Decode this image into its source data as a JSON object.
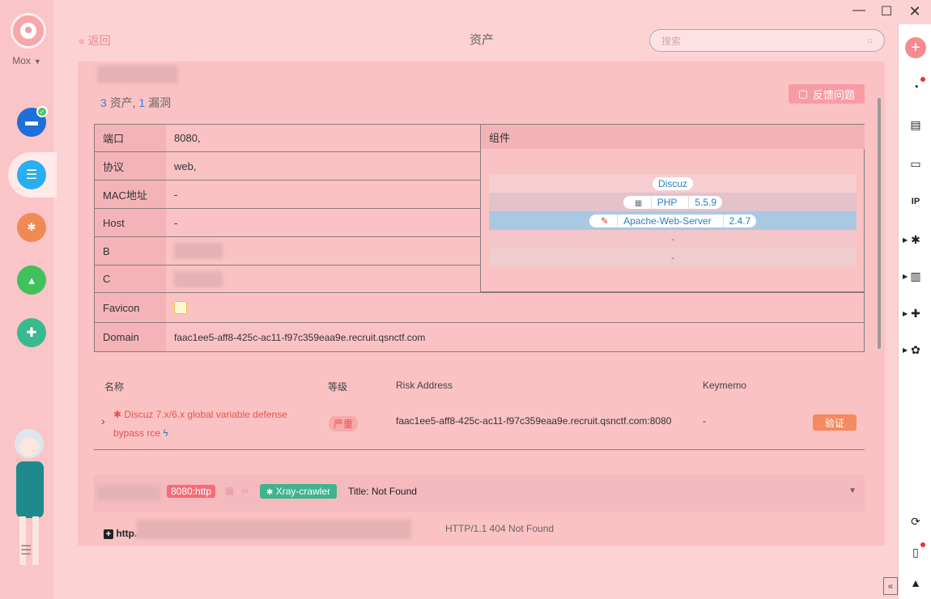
{
  "sidebar": {
    "user": "Mox",
    "nav": [
      {
        "name": "scan-icon",
        "color": "#1e6fd8"
      },
      {
        "name": "assets-icon",
        "color": "#2aaef0"
      },
      {
        "name": "bug-icon",
        "color": "#f08a55"
      },
      {
        "name": "chart-icon",
        "color": "#3fc15c"
      },
      {
        "name": "plugin-icon",
        "color": "#38b98f"
      }
    ]
  },
  "header": {
    "back_label": "返回",
    "title": "资产",
    "search_placeholder": "搜索"
  },
  "summary": {
    "asset_count": "3",
    "asset_label": "资产,",
    "vuln_count": "1",
    "vuln_label": "漏洞"
  },
  "feedback_label": "反馈问题",
  "info": {
    "port_label": "端口",
    "port_value": "8080,",
    "protocol_label": "协议",
    "protocol_value": "web,",
    "mac_label": "MAC地址",
    "mac_value": "-",
    "host_label": "Host",
    "host_value": "-",
    "b_label": "B",
    "c_label": "C",
    "favicon_label": "Favicon",
    "domain_label": "Domain",
    "domain_value": "faac1ee5-aff8-425c-ac11-f97c359eaa9e.recruit.qsnctf.com"
  },
  "components": {
    "header": "组件",
    "items": [
      {
        "name": "Discuz",
        "version": ""
      },
      {
        "name": "PHP",
        "version": "5.5.9"
      },
      {
        "name": "Apache-Web-Server",
        "version": "2.4.7"
      },
      {
        "name": "-",
        "version": ""
      },
      {
        "name": "-",
        "version": ""
      }
    ]
  },
  "vuln_table": {
    "headers": {
      "name": "名称",
      "level": "等级",
      "risk": "Risk Address",
      "keymemo": "Keymemo"
    },
    "rows": [
      {
        "name": "Discuz 7.x/6.x global variable defense bypass rce",
        "level": "严重",
        "risk_address": "faac1ee5-aff8-425c-ac11-f97c359eaa9e.recruit.qsnctf.com:8080",
        "keymemo": "-",
        "action": "验证"
      }
    ]
  },
  "result": {
    "port_tag": "8080:http",
    "source_tag": "Xray-crawler",
    "title": "Title: Not Found",
    "http_label": "http.",
    "http_status": "HTTP/1.1 404 Not Found"
  }
}
